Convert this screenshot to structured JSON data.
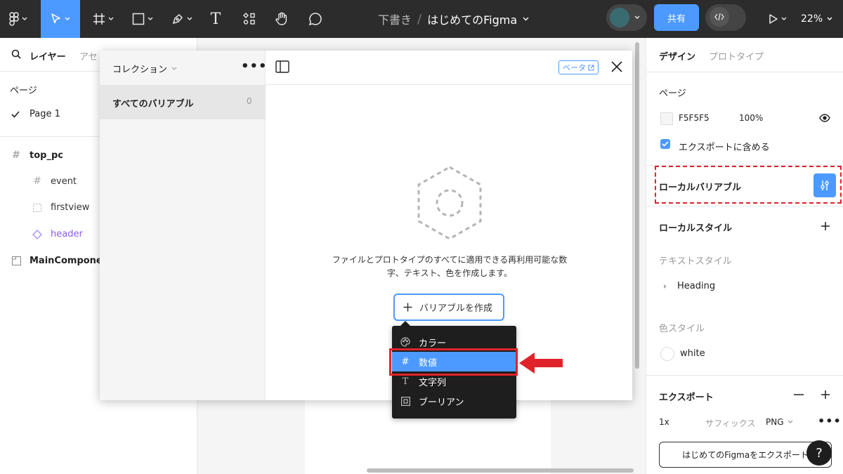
{
  "toolbar": {
    "breadcrumb_folder": "下書き",
    "breadcrumb_sep": "/",
    "file_name": "はじめてのFigma",
    "share_label": "共有",
    "zoom": "22%",
    "text_tool_glyph": "T",
    "accent_color": "#4c9aff"
  },
  "left_panel": {
    "tab_layers": "レイヤー",
    "tab_assets": "アセ",
    "pages_title": "ページ",
    "current_page": "Page 1",
    "layers": [
      {
        "name": "top_pc",
        "icon": "frame-icon"
      },
      {
        "name": "event",
        "icon": "frame-icon"
      },
      {
        "name": "firstview",
        "icon": "dashed-frame-icon"
      },
      {
        "name": "header",
        "icon": "component-instance-icon"
      },
      {
        "name": "MainComponen",
        "icon": "section-icon"
      }
    ]
  },
  "modal": {
    "collection_label": "コレクション",
    "more": "•••",
    "all_variables": "すべてのバリアブル",
    "variable_count": "0",
    "beta_label": "ベータ",
    "empty_description": "ファイルとプロトタイプのすべてに適用できる再利用可能な数字、テキスト、色を作成します。",
    "create_button": "バリアブルを作成"
  },
  "menu": {
    "items": [
      {
        "label": "カラー",
        "icon": "palette-icon"
      },
      {
        "label": "数値",
        "icon": "hash-icon",
        "highlighted": true
      },
      {
        "label": "文字列",
        "icon": "text-icon"
      },
      {
        "label": "ブーリアン",
        "icon": "boolean-icon"
      }
    ]
  },
  "right_panel": {
    "tab_design": "デザイン",
    "tab_prototype": "プロトタイプ",
    "page_section": "ページ",
    "page_color": "F5F5F5",
    "page_opacity": "100%",
    "export_checkbox_label": "エクスポートに含める",
    "local_variables": "ローカルバリアブル",
    "local_styles": "ローカルスタイル",
    "text_styles_label": "テキストスタイル",
    "text_style_heading": "Heading",
    "color_styles_label": "色スタイル",
    "color_style_white": "white",
    "export_section": "エクスポート",
    "export_scale": "1x",
    "export_suffix_placeholder": "サフィックス",
    "export_format": "PNG",
    "export_button": "はじめてのFigmaをエクスポート",
    "help_glyph": "?"
  },
  "annotation_color": "#e0232a"
}
